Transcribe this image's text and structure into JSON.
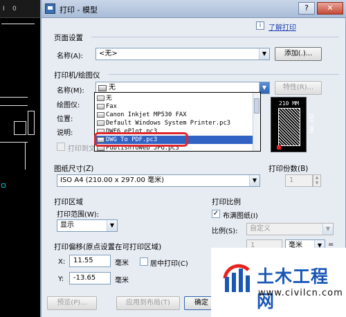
{
  "background": {
    "tab_label_1": "I",
    "tab_label_2": "0"
  },
  "dialog": {
    "title": "打印 - 模型",
    "help_link": "了解打印",
    "help_icon_glyph": "i",
    "close_glyph": "✕",
    "help_glyph": "?"
  },
  "page_setup": {
    "title": "页面设置",
    "name_label": "名称(A):",
    "name_value": "<无>",
    "add_button": "添加(.)..."
  },
  "printer": {
    "title": "打印机/绘图仪",
    "name_label": "名称(M):",
    "name_value": "无",
    "properties_button": "特性(R)...",
    "plotter_label": "绘图仪:",
    "location_label": "位置:",
    "description_label": "说明:",
    "print_to_file_label": "打印到文",
    "dropdown_items": [
      "无",
      "Fax",
      "Canon Inkjet MP530 FAX",
      "Default Windows System Printer.pc3",
      "DWF6 ePlot.pc3",
      "DWG To PDF.pc3",
      "PublishToWeb JPG.pc3"
    ],
    "selected_index": 5
  },
  "preview": {
    "width_label": "210 MM",
    "height_label": "297 MM"
  },
  "paper_size": {
    "title": "图纸尺寸(Z)",
    "value": "ISO A4 (210.00 x 297.00 毫米)"
  },
  "copies": {
    "title": "打印份数(B)",
    "value": "1"
  },
  "plot_area": {
    "title": "打印区域",
    "range_label": "打印范围(W):",
    "range_value": "显示"
  },
  "plot_scale": {
    "title": "打印比例",
    "fit_label": "布满图纸(I)",
    "fit_checked": true,
    "scale_label": "比例(S):",
    "scale_value": "自定义",
    "ratio_value": "1",
    "unit_value": "毫米",
    "equals": "="
  },
  "plot_offset": {
    "title": "打印偏移(原点设置在可打印区域)",
    "x_label": "X:",
    "x_value": "11.55",
    "x_unit": "毫米",
    "center_label": "居中打印(C)",
    "y_label": "Y:",
    "y_value": "-13.65",
    "y_unit": "毫米"
  },
  "footer": {
    "preview_button": "预览(P)...",
    "apply_button": "应用到布局(T)",
    "ok_button": "确定"
  },
  "watermark": {
    "title": "土木工程网",
    "url": "www.civilcn.com"
  }
}
